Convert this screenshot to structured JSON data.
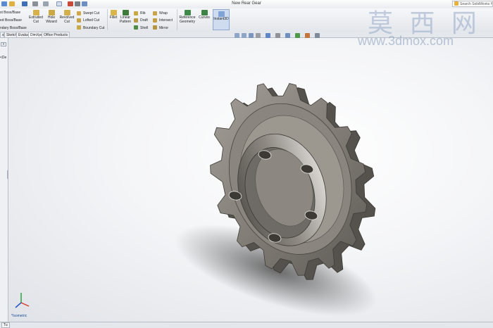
{
  "window": {
    "title": "New Rear Gear"
  },
  "search": {
    "text": "Search SolidWorks Help"
  },
  "watermark": {
    "chinese": "莫 西 网",
    "url": "www.3dmox.com"
  },
  "ribbon": {
    "boss_base": [
      "xt Boss/Base",
      "ed Boss/Base",
      "ndary Boss/Base"
    ],
    "extruded_cut": [
      "Extruded",
      "Cut"
    ],
    "hole_wizard": [
      "Hole",
      "Wizard"
    ],
    "revolved_cut": [
      "Revolved",
      "Cut"
    ],
    "swept_cut": "Swept Cut",
    "lofted_cut": "Lofted Cut",
    "boundary_cut": "Boundary Cut",
    "fillet": "Fillet",
    "linear_pattern": [
      "Linear",
      "Pattern"
    ],
    "rib": "Rib",
    "draft": "Draft",
    "shell": "Shell",
    "wrap": "Wrap",
    "intersect": "Intersect",
    "mirror": "Mirror",
    "reference_geometry": [
      "Reference",
      "Geometry"
    ],
    "curves": "Curves",
    "instant3d": "Instant3D"
  },
  "tabs": [
    "s",
    "Sketch",
    "Evaluate",
    "DimXpert",
    "Office Products"
  ],
  "left_panel": {
    "item": "<De"
  },
  "view": {
    "orientation_label": "*Isometric"
  },
  "statusbar": {
    "tab": "Tu"
  },
  "colors": {
    "accent": "#8ea8cf",
    "part_body": "#7d7872",
    "viewport_bg": "#eef0f3"
  },
  "icons": [
    "search-icon",
    "extruded-cut-icon",
    "hole-wizard-icon",
    "revolved-cut-icon",
    "fillet-icon",
    "linear-pattern-icon",
    "rib-icon",
    "draft-icon",
    "shell-icon",
    "wrap-icon",
    "intersect-icon",
    "mirror-icon",
    "reference-geometry-icon",
    "curves-icon",
    "instant3d-icon",
    "triad-icon"
  ]
}
